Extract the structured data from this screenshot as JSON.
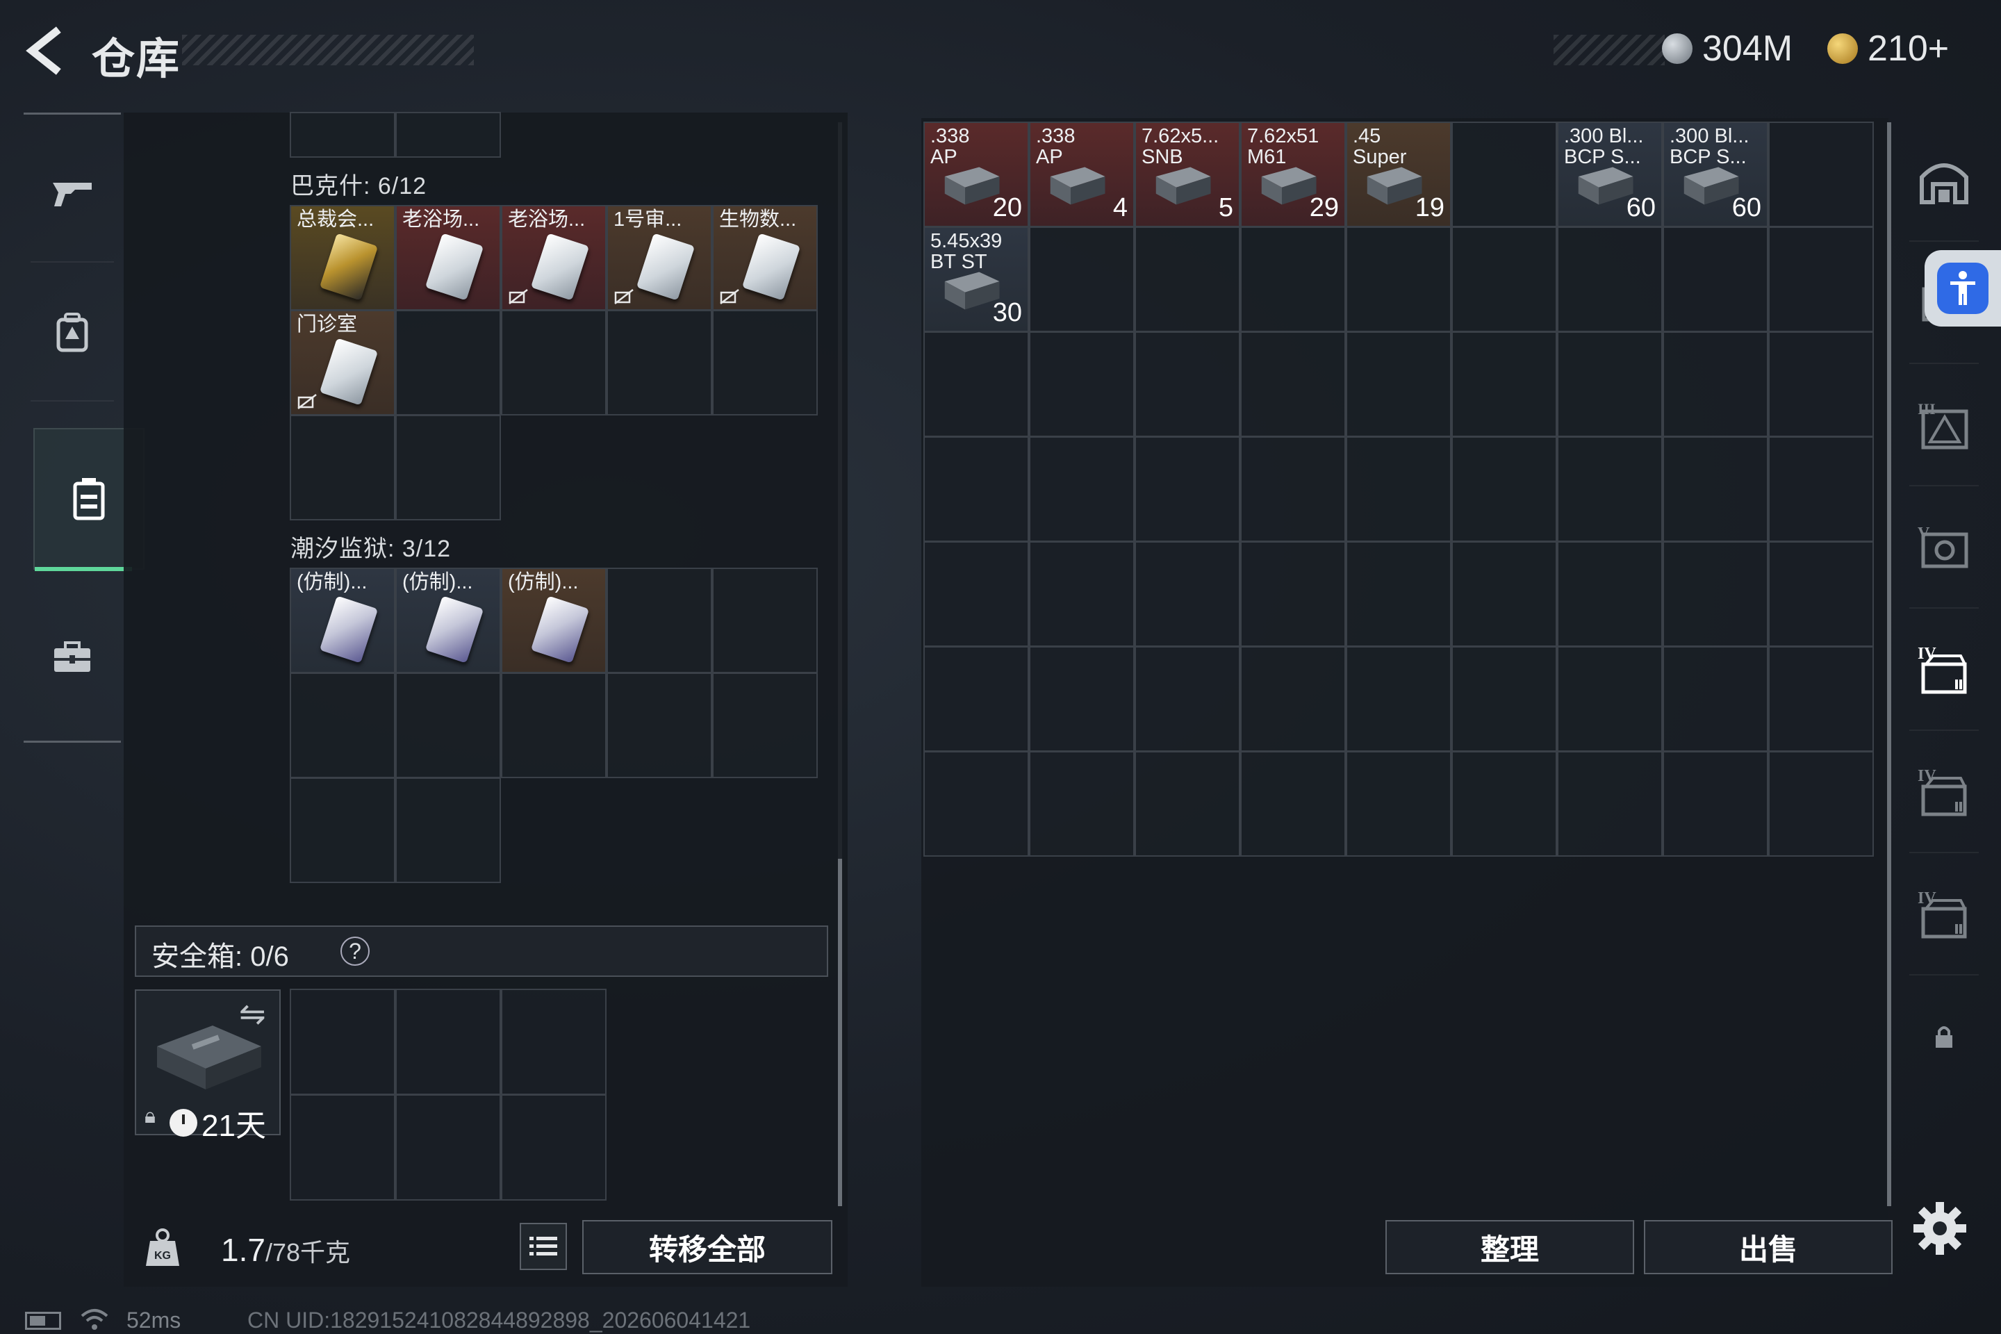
{
  "header": {
    "title": "仓库",
    "currency_silver": "304M",
    "currency_gold": "210+"
  },
  "left_nav": {
    "items": [
      {
        "icon": "gun-icon"
      },
      {
        "icon": "backpack-icon"
      },
      {
        "icon": "storage-icon",
        "active": true
      },
      {
        "icon": "toolbox-icon"
      }
    ]
  },
  "storage": {
    "bakesh": {
      "label": "巴克什: 6/12",
      "items": [
        {
          "name": "总裁会...",
          "rarity": "gold"
        },
        {
          "name": "老浴场...",
          "rarity": "red"
        },
        {
          "name": "老浴场...",
          "rarity": "red"
        },
        {
          "name": "1号审...",
          "rarity": "brown"
        },
        {
          "name": "生物数...",
          "rarity": "brown"
        },
        {
          "name": "门诊室",
          "rarity": "brown"
        }
      ]
    },
    "tidal": {
      "label": "潮汐监狱: 3/12",
      "items": [
        {
          "name": "(仿制)...",
          "rarity": "dark"
        },
        {
          "name": "(仿制)...",
          "rarity": "dark"
        },
        {
          "name": "(仿制)...",
          "rarity": "brown"
        }
      ]
    }
  },
  "safe_box": {
    "label": "安全箱: 0/6",
    "help": "?",
    "days": "21天"
  },
  "footer_left": {
    "weight_current": "1.7",
    "weight_max": "/78千克",
    "transfer_all": "转移全部"
  },
  "right_grid": {
    "items": [
      {
        "name": ".338\nAP",
        "qty": "20",
        "rarity": "red",
        "col": 0,
        "row": 0
      },
      {
        "name": ".338\nAP",
        "qty": "4",
        "rarity": "red",
        "col": 1,
        "row": 0
      },
      {
        "name": "7.62x5...\nSNB",
        "qty": "5",
        "rarity": "red",
        "col": 2,
        "row": 0
      },
      {
        "name": "7.62x51\nM61",
        "qty": "29",
        "rarity": "red",
        "col": 3,
        "row": 0
      },
      {
        "name": ".45\nSuper",
        "qty": "19",
        "rarity": "brown",
        "col": 4,
        "row": 0
      },
      {
        "name": ".300 Bl...\nBCP S...",
        "qty": "60",
        "rarity": "dark",
        "col": 6,
        "row": 0
      },
      {
        "name": ".300 Bl...\nBCP S...",
        "qty": "60",
        "rarity": "dark",
        "col": 7,
        "row": 0
      },
      {
        "name": "5.45x39\nBT ST",
        "qty": "30",
        "rarity": "dark",
        "col": 0,
        "row": 1
      }
    ],
    "sort": "整理",
    "sell": "出售"
  },
  "right_nav": {
    "items": [
      {
        "icon": "storage-arch-icon"
      },
      {
        "icon": "crate-icon"
      },
      {
        "icon": "shelf-3-icon",
        "tier": "III"
      },
      {
        "icon": "shelf-5-icon",
        "tier": "V"
      },
      {
        "icon": "shelf-4-active-icon",
        "tier": "IV"
      },
      {
        "icon": "shelf-4-icon",
        "tier": "IV"
      },
      {
        "icon": "shelf-4b-icon",
        "tier": "IV"
      },
      {
        "icon": "lock-icon"
      }
    ]
  },
  "status_bar": {
    "ping": "52ms",
    "uid": "CN UID:182915241082844892898_202606041421"
  }
}
